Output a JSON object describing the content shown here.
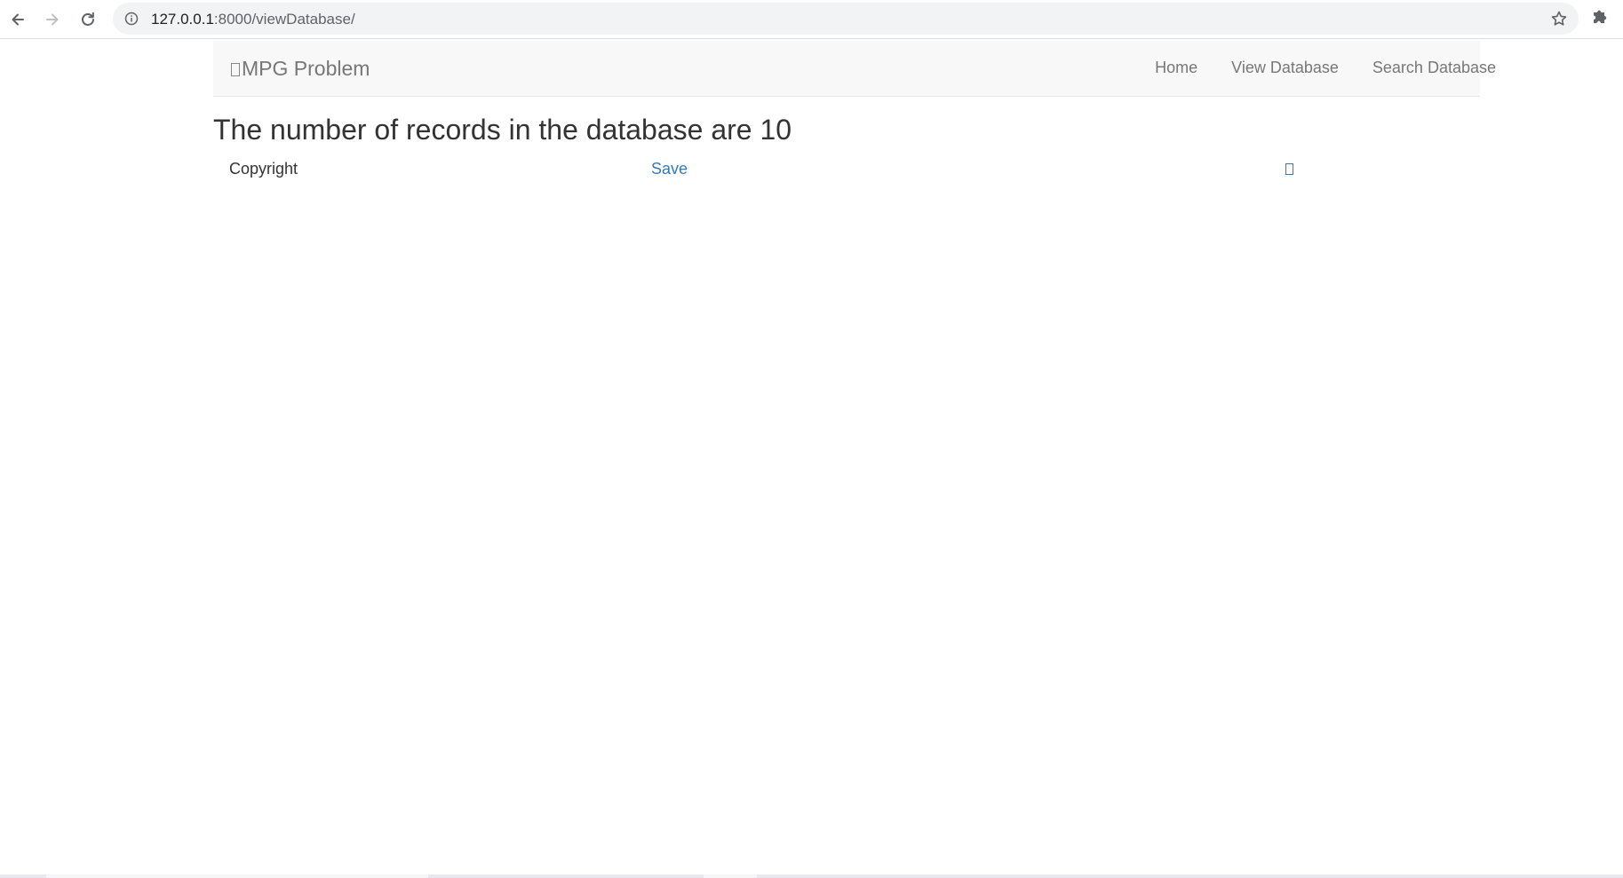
{
  "browser": {
    "url_host": "127.0.0.1",
    "url_path": ":8000/viewDatabase/",
    "icons": {
      "back": "arrow-left-icon",
      "forward": "arrow-right-icon",
      "reload": "reload-icon",
      "info": "info-icon",
      "bookmark": "star-icon",
      "extensions": "puzzle-icon"
    }
  },
  "navbar": {
    "brand": "MPG Problem",
    "links": [
      "Home",
      "View Database",
      "Search Database"
    ]
  },
  "main": {
    "heading": "The number of records in the database are 10"
  },
  "footer": {
    "copyright": "Copyright",
    "save_link": "Save"
  },
  "colors": {
    "link": "#337ab7",
    "navbar_bg": "#f8f8f8",
    "navbar_text": "#777777",
    "text": "#333333"
  }
}
